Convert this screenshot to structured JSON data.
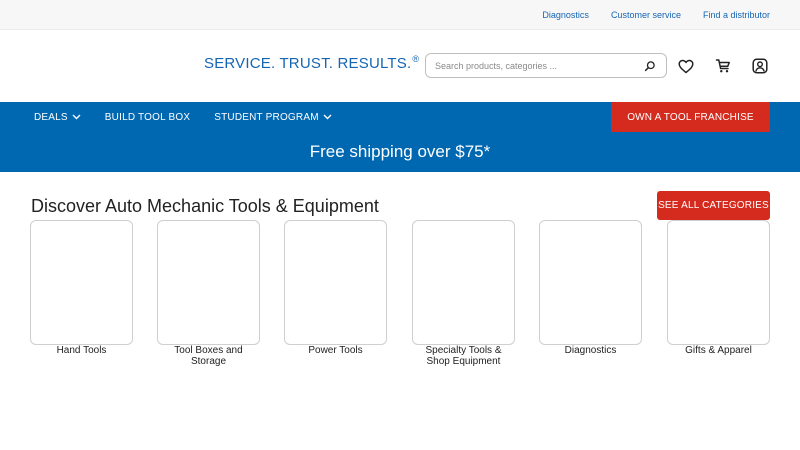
{
  "utility": {
    "links": [
      "Diagnostics",
      "Customer service",
      "Find a distributor"
    ]
  },
  "header": {
    "tagline": "SERVICE. TRUST. RESULTS.",
    "tagline_mark": "®",
    "search_placeholder": "Search products, categories ..."
  },
  "icons": {
    "search": "search-icon",
    "wishlist": "heart-icon",
    "cart": "cart-icon",
    "account": "user-icon",
    "chevron": "chevron-down-icon"
  },
  "nav": {
    "items": [
      {
        "label": "DEALS"
      },
      {
        "label": "BUILD TOOL BOX"
      },
      {
        "label": "STUDENT PROGRAM"
      }
    ],
    "franchise_label": "OWN A TOOL FRANCHISE",
    "shipping_banner": "Free shipping over $75*"
  },
  "main": {
    "title": "Discover Auto Mechanic Tools & Equipment",
    "see_all_label": "SEE ALL CATEGORIES",
    "categories": [
      {
        "label": "Hand Tools"
      },
      {
        "label": "Tool Boxes and Storage"
      },
      {
        "label": "Power Tools"
      },
      {
        "label": "Specialty Tools & Shop Equipment"
      },
      {
        "label": "Diagnostics"
      },
      {
        "label": "Gifts & Apparel"
      }
    ]
  },
  "colors": {
    "brand_blue": "#0067b1",
    "accent_red": "#d52b1e",
    "link_blue": "#1565b4"
  }
}
